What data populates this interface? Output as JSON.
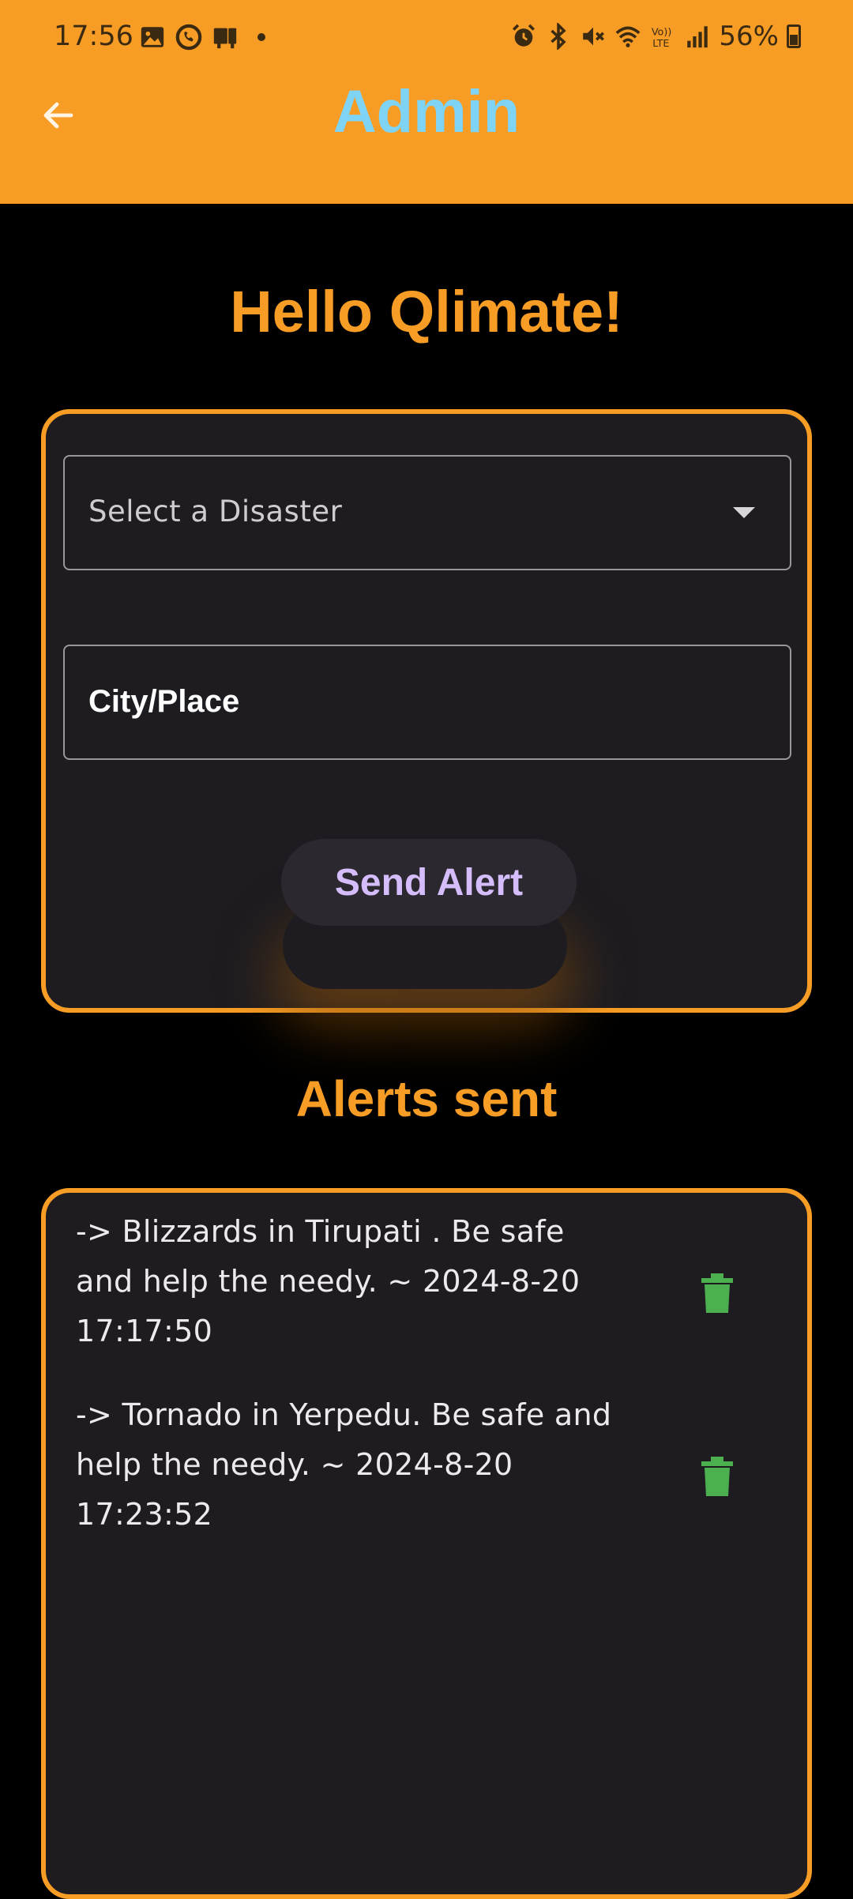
{
  "status_bar": {
    "time": "17:56",
    "battery": "56%",
    "left_icons": [
      "gallery-icon",
      "whatsapp-icon",
      "cast-icon"
    ],
    "right_icons": [
      "alarm-icon",
      "bluetooth-icon",
      "mute-icon",
      "wifi-icon",
      "volte-icon",
      "signal-icon",
      "battery-icon"
    ]
  },
  "app_bar": {
    "title": "Admin",
    "back_icon": "arrow-left-icon"
  },
  "greeting": "Hello Qlimate!",
  "form": {
    "disaster_select": {
      "placeholder": "Select a Disaster"
    },
    "city_field": {
      "label": "City/Place"
    },
    "send_button": "Send Alert"
  },
  "alerts": {
    "heading": "Alerts sent",
    "items": [
      {
        "text": "->  Blizzards in Tirupati . Be safe and help the needy. ~ 2024-8-20 17:17:50",
        "icon": "trash-icon"
      },
      {
        "text": "->  Tornado in Yerpedu. Be safe and help the needy. ~ 2024-8-20 17:23:52",
        "icon": "trash-icon"
      }
    ]
  },
  "colors": {
    "accent": "#f79d25",
    "title": "#7fd3f5",
    "button_text": "#d4bdfa",
    "trash": "#4caf50",
    "card_bg": "#1e1c20",
    "page_bg": "#000000"
  }
}
